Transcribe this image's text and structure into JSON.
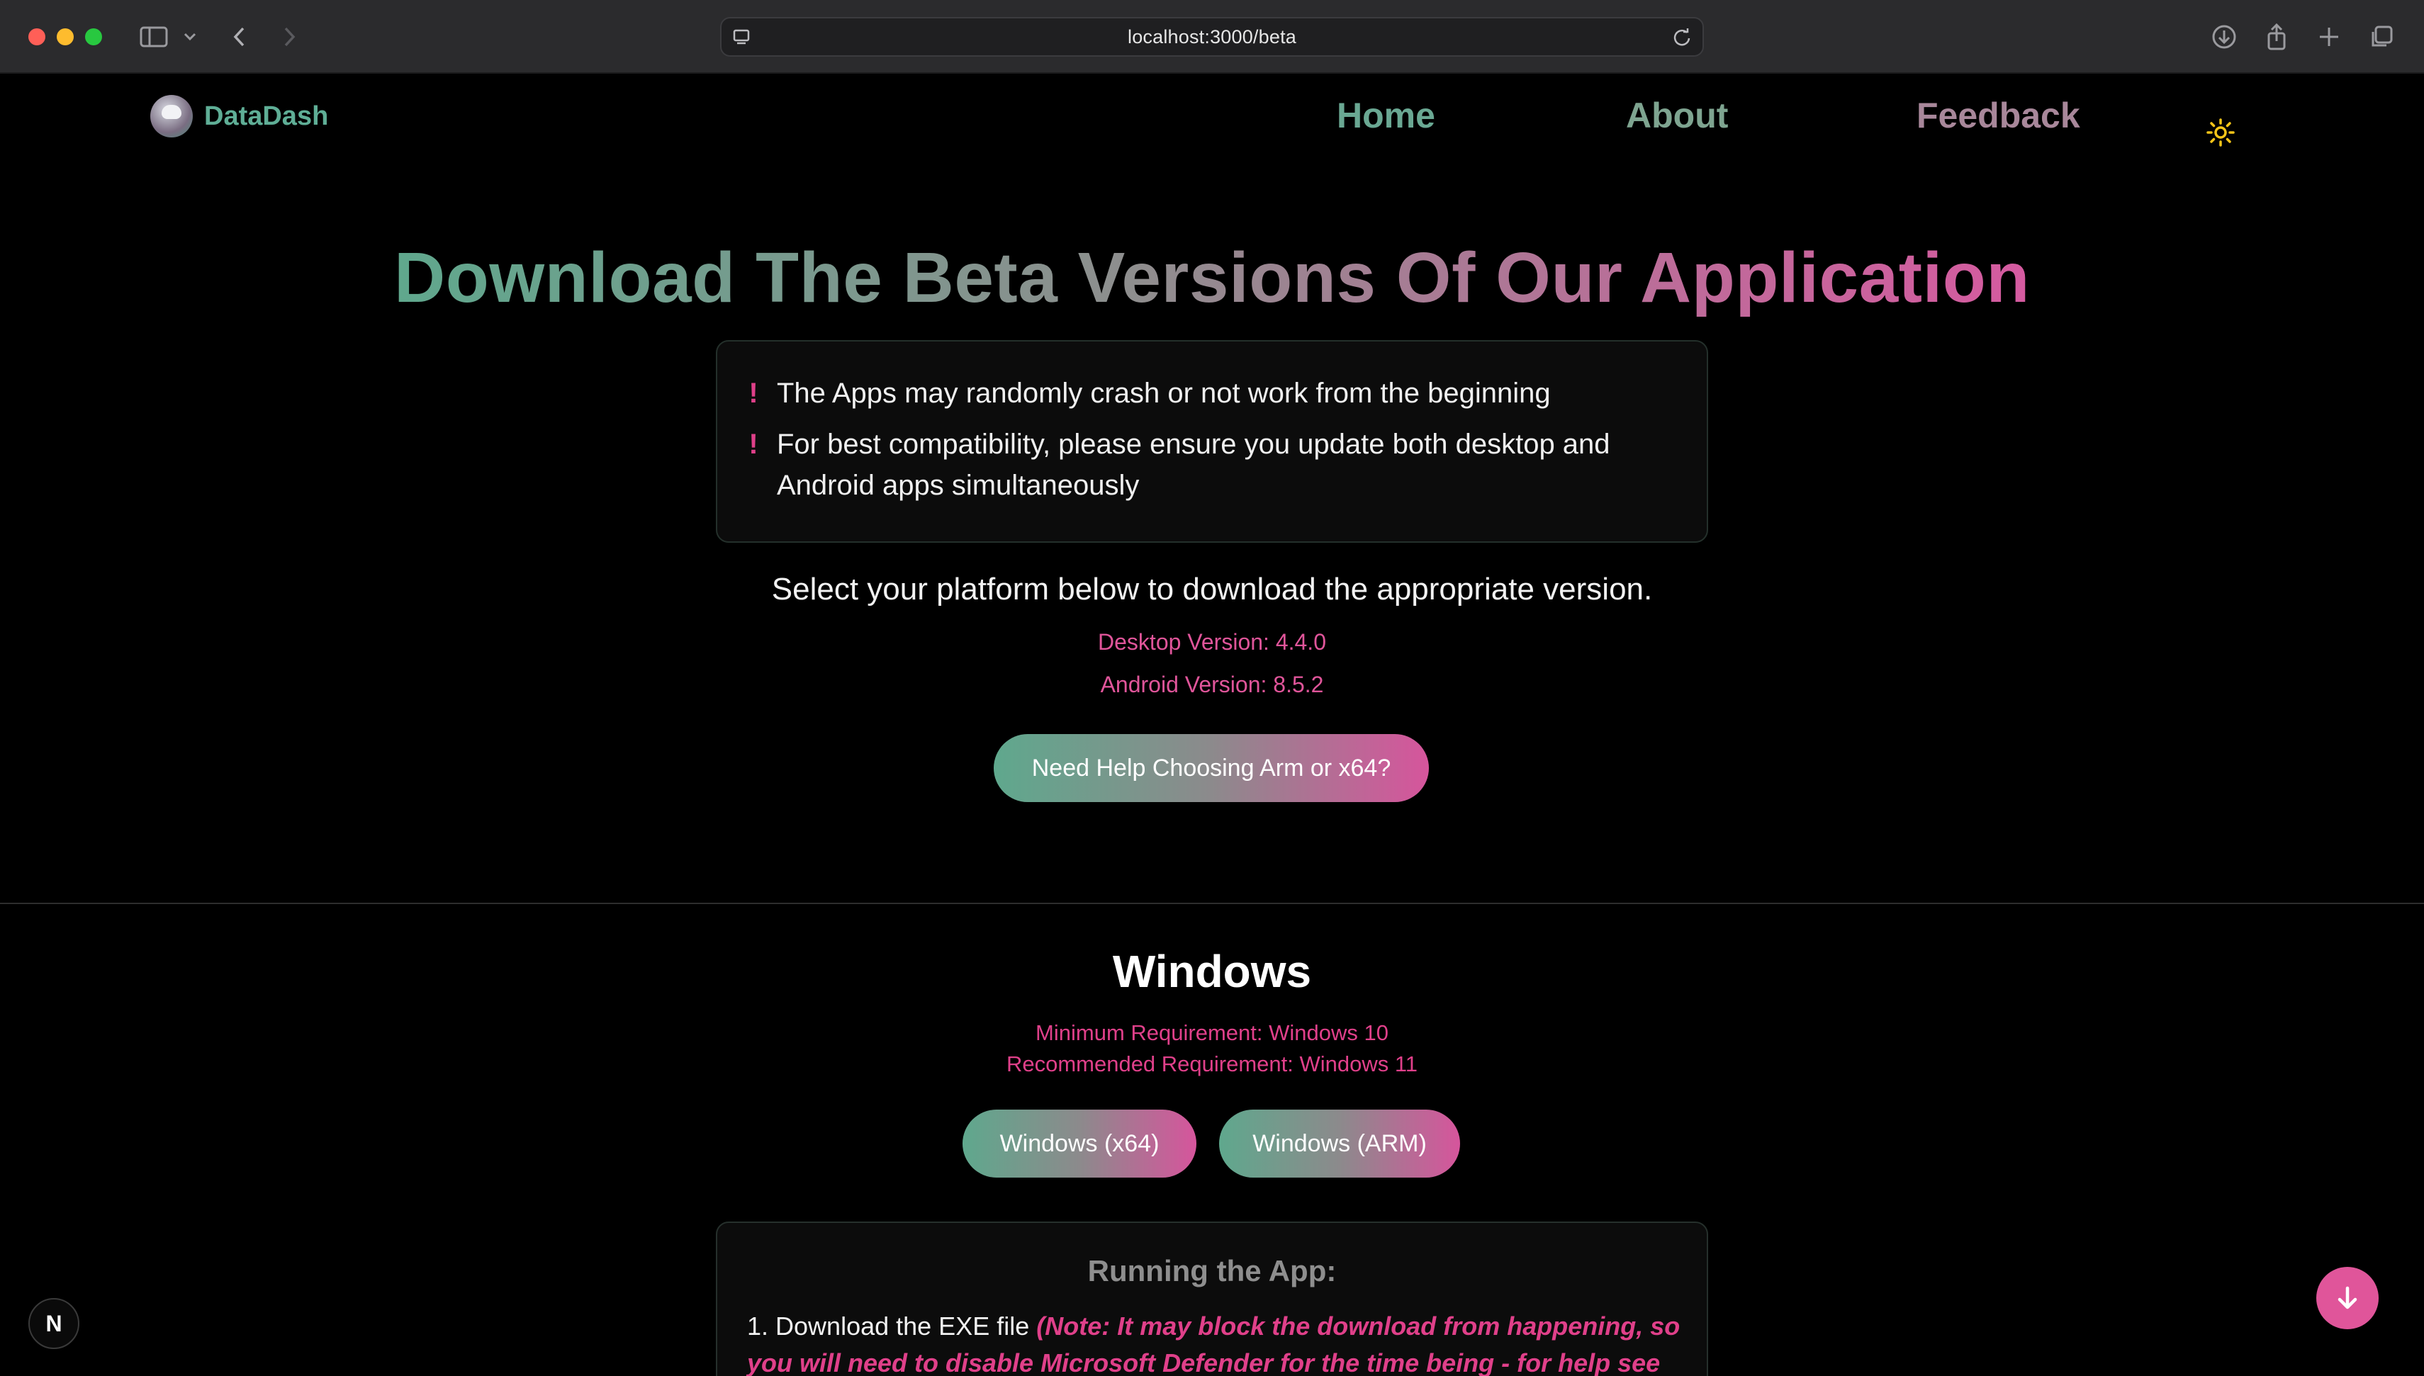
{
  "browser": {
    "url": "localhost:3000/beta"
  },
  "nav": {
    "brand": "DataDash",
    "links": [
      "Home",
      "About",
      "Feedback"
    ]
  },
  "hero": {
    "title": "Download The Beta Versions Of Our Application",
    "warnings": [
      "The Apps may randomly crash or not work from the beginning",
      "For best compatibility, please ensure you update both desktop and Android apps simultaneously"
    ],
    "warning_mark": "!",
    "select_text": "Select your platform below to download the appropriate version.",
    "desktop_version": "Desktop Version: 4.4.0",
    "android_version": "Android Version: 8.5.2",
    "help_button": "Need Help Choosing Arm or x64?"
  },
  "windows": {
    "title": "Windows",
    "min_req": "Minimum Requirement: Windows 10",
    "rec_req": "Recommended Requirement: Windows 11",
    "btn_x64": "Windows (x64)",
    "btn_arm": "Windows (ARM)",
    "running_title": "Running the App:",
    "step1": "1. Download the EXE file ",
    "step1_note": "(Note: It may block the download from happening, so you will need to disable Microsoft Defender for the time being - for help see the video"
  },
  "badge": {
    "letter": "N"
  },
  "colors": {
    "accent_pink": "#e0408a",
    "accent_green": "#5fa88d",
    "background": "#000000"
  }
}
